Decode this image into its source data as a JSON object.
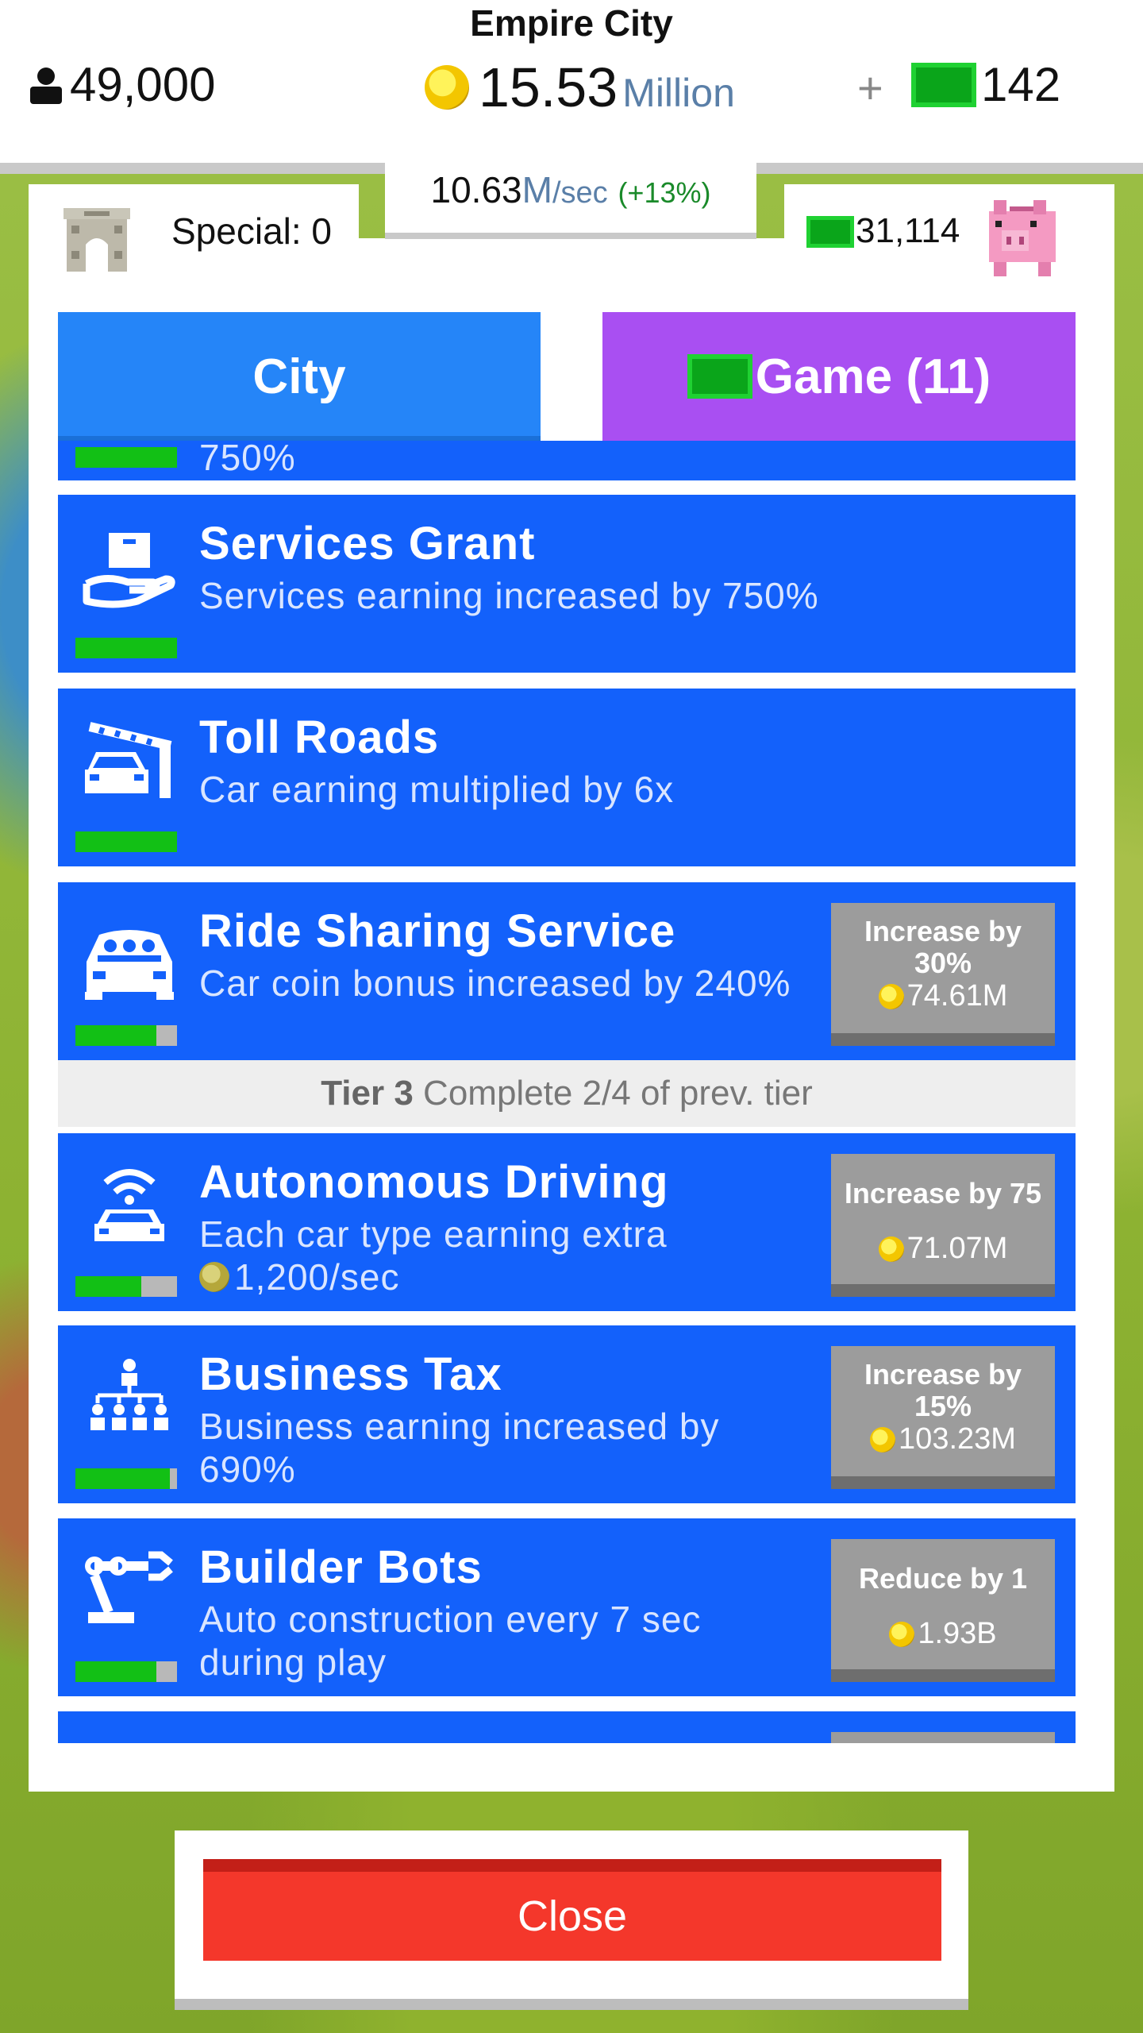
{
  "header": {
    "city_name": "Empire City",
    "population": "49,000",
    "coins": "15.53",
    "coins_unit": "Million",
    "plus": "+",
    "cash": "142",
    "rate_value": "10.63",
    "rate_unit": "M",
    "rate_suffix": "/sec",
    "rate_bonus": "(+13%)"
  },
  "panel": {
    "special_label": "Special: 0",
    "bank_cash": "31,114"
  },
  "tabs": {
    "city": "City",
    "game": "Game (11)"
  },
  "upgrades": [
    {
      "title": "",
      "desc": "750%",
      "progress": 1.0
    },
    {
      "title": "Services Grant",
      "desc": "Services earning increased by 750%",
      "progress": 1.0,
      "icon": "hand-box-icon"
    },
    {
      "title": "Toll Roads",
      "desc": "Car earning multiplied by 6x",
      "progress": 1.0,
      "icon": "toll-car-icon"
    },
    {
      "title": "Ride Sharing Service",
      "desc": "Car coin bonus increased by 240%",
      "progress": 0.8,
      "icon": "rideshare-car-icon",
      "button": {
        "line1": "Increase by",
        "line2": "30%",
        "price": "74.61M"
      }
    },
    {
      "title": "Autonomous Driving",
      "desc": "Each car type earning extra",
      "desc2": "1,200/sec",
      "progress": 0.65,
      "icon": "wifi-car-icon",
      "button": {
        "line1": "Increase by 75",
        "price": "71.07M"
      }
    },
    {
      "title": "Business Tax",
      "desc": "Business earning increased by",
      "desc2": "690%",
      "progress": 0.93,
      "icon": "org-chart-icon",
      "button": {
        "line1": "Increase by",
        "line2": "15%",
        "price": "103.23M"
      }
    },
    {
      "title": "Builder Bots",
      "desc": "Auto construction every 7 sec",
      "desc2": "during play",
      "progress": 0.8,
      "icon": "robot-arm-icon",
      "button": {
        "line1": "Reduce by 1",
        "price": "1.93B"
      }
    }
  ],
  "tier": {
    "label": "Tier 3",
    "text": "Complete 2/4 of prev. tier"
  },
  "close_label": "Close"
}
